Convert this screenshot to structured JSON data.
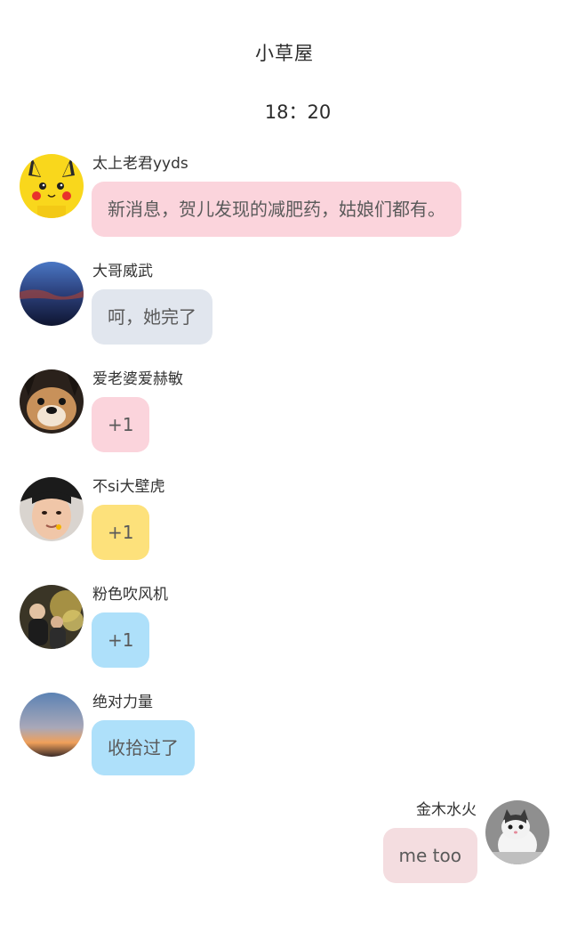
{
  "header": {
    "title": "小草屋",
    "time": "18：20"
  },
  "messages": [
    {
      "sender": "太上老君yyds",
      "text": "新消息，贺儿发现的减肥药，姑娘们都有。",
      "bubble_color": "#fbd4dc",
      "avatar": "pikachu-avatar"
    },
    {
      "sender": "大哥威武",
      "text": "呵，她完了",
      "bubble_color": "#e1e6ee",
      "avatar": "night-sky-avatar"
    },
    {
      "sender": "爱老婆爱赫敏",
      "text": "+1",
      "bubble_color": "#fbd4dc",
      "avatar": "dog-avatar"
    },
    {
      "sender": "不si大壁虎",
      "text": "+1",
      "bubble_color": "#fde17b",
      "avatar": "boy-face-avatar"
    },
    {
      "sender": "粉色吹风机",
      "text": "+1",
      "bubble_color": "#aee0fa",
      "avatar": "people-outdoor-avatar"
    },
    {
      "sender": "绝对力量",
      "text": "收拾过了",
      "bubble_color": "#aee0fa",
      "avatar": "sunset-avatar"
    },
    {
      "sender": "金木水火",
      "text": "me too",
      "bubble_color": "#f4dde0",
      "avatar": "cat-avatar",
      "self": true
    }
  ]
}
